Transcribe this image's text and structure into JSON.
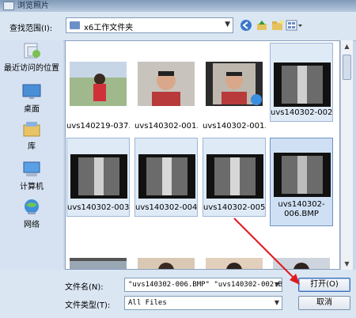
{
  "window": {
    "title": "浏览照片"
  },
  "toolbar": {
    "look_in_label": "查找范围(I):",
    "look_in_value": "x6工作文件夹",
    "icons": [
      "back-icon",
      "up-folder-icon",
      "new-folder-icon",
      "view-menu-icon"
    ]
  },
  "places": [
    {
      "label": "最近访问的位置",
      "icon": "recent-places-icon"
    },
    {
      "label": "桌面",
      "icon": "desktop-icon"
    },
    {
      "label": "库",
      "icon": "libraries-icon"
    },
    {
      "label": "计算机",
      "icon": "computer-icon"
    },
    {
      "label": "网络",
      "icon": "network-icon"
    }
  ],
  "files": [
    {
      "name": "uvs140219-037...",
      "state": "normal",
      "kind": "photo-red"
    },
    {
      "name": "uvs140302-001...",
      "state": "normal",
      "kind": "photo-face"
    },
    {
      "name": "uvs140302-001...",
      "state": "normal",
      "kind": "video-face"
    },
    {
      "name": "uvs140302-002...",
      "state": "selected",
      "kind": "dark-strip"
    },
    {
      "name": "uvs140302-003...",
      "state": "selected",
      "kind": "dark-strip"
    },
    {
      "name": "uvs140302-004...",
      "state": "selected",
      "kind": "dark-strip"
    },
    {
      "name": "uvs140302-005...",
      "state": "selected",
      "kind": "dark-strip"
    },
    {
      "name": "uvs140302-006.BMP",
      "state": "focused",
      "kind": "dark-strip"
    },
    {
      "name": "",
      "state": "normal",
      "kind": "filmstrip"
    },
    {
      "name": "",
      "state": "normal",
      "kind": "photo-woman"
    },
    {
      "name": "",
      "state": "normal",
      "kind": "photo-woman"
    },
    {
      "name": "",
      "state": "normal",
      "kind": "photo-woman"
    }
  ],
  "bottom": {
    "filename_label": "文件名(N):",
    "filename_value": "\"uvs140302-006.BMP\" \"uvs140302-002.BM",
    "filetype_label": "文件类型(T):",
    "filetype_value": "All Files",
    "open_label": "打开(O)",
    "cancel_label": "取消"
  }
}
